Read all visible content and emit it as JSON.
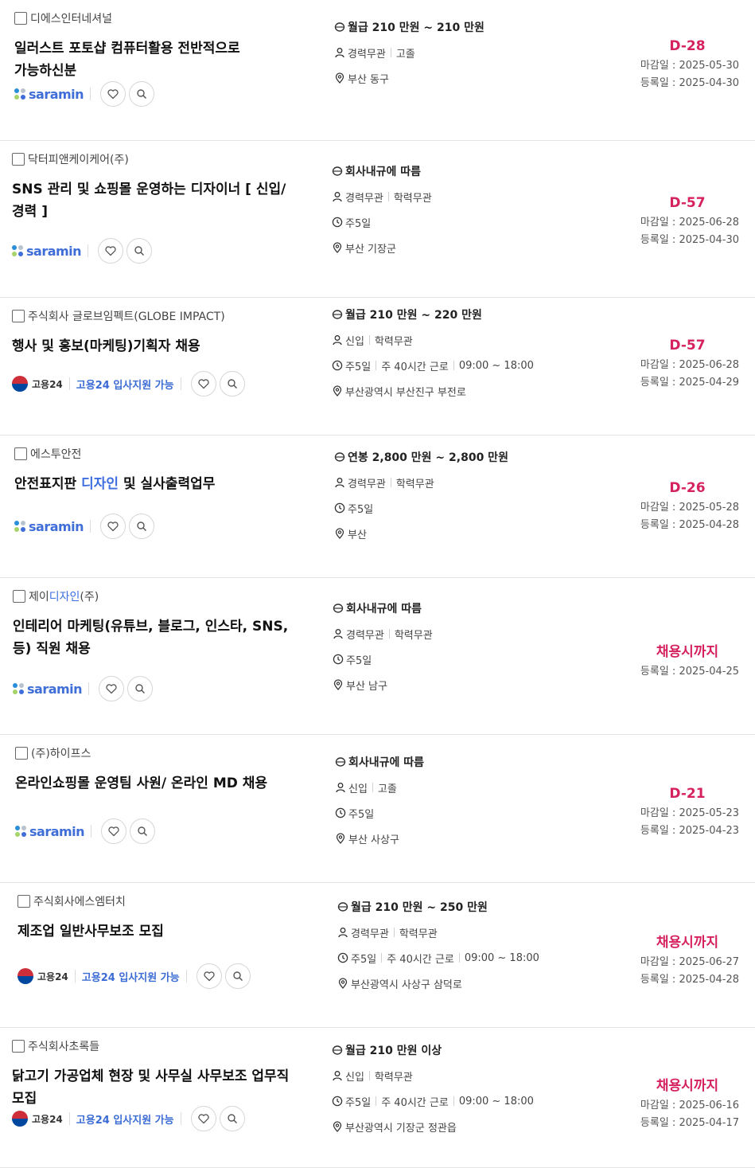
{
  "colors": {
    "accent": "#d6215f",
    "link": "#3b6bd4",
    "saramin": "#3f6ed8"
  },
  "icons": {
    "salary": "coin-icon",
    "career": "person-icon",
    "schedule": "clock-icon",
    "location": "pin-icon",
    "like": "heart-icon",
    "search": "search-icon"
  },
  "jobs": [
    {
      "company": "디에스인터네셔널",
      "title": "일러스트 포토샵 컴퓨터활용 전반적으로 가능하신분",
      "source": "saramin",
      "salary": "월급 210 만원 ~ 210 만원",
      "career": [
        "경력무관",
        "고졸"
      ],
      "schedule": [],
      "location": "부산 동구",
      "dday": "D-28",
      "deadline": "마감일 : 2025-05-30",
      "registered": "등록일 : 2025-04-30"
    },
    {
      "company": "닥터피앤케이케어(주)",
      "title": "SNS 관리 및 쇼핑몰 운영하는 디자이너 [ 신입/경력 ]",
      "source": "saramin",
      "salary": "회사내규에 따름",
      "career": [
        "경력무관",
        "학력무관"
      ],
      "schedule": [
        "주5일"
      ],
      "location": "부산 기장군",
      "dday": "D-57",
      "deadline": "마감일 : 2025-06-28",
      "registered": "등록일 : 2025-04-30"
    },
    {
      "company": "주식회사 글로브임펙트(GLOBE IMPACT)",
      "title": "행사 및 홍보(마케팅)기획자 채용",
      "source": "gov",
      "salary": "월급 210 만원 ~ 220 만원",
      "career": [
        "신입",
        "학력무관"
      ],
      "schedule": [
        "주5일",
        "주 40시간 근로",
        "09:00 ~ 18:00"
      ],
      "location": "부산광역시 부산진구 부전로",
      "dday": "D-57",
      "deadline": "마감일 : 2025-06-28",
      "registered": "등록일 : 2025-04-29"
    },
    {
      "company": "에스투안전",
      "title_pre": "안전표지판 ",
      "title_hl": "디자인",
      "title_post": " 및 실사출력업무",
      "source": "saramin",
      "salary": "연봉 2,800 만원 ~ 2,800 만원",
      "career": [
        "경력무관",
        "학력무관"
      ],
      "schedule": [
        "주5일"
      ],
      "location": "부산",
      "dday": "D-26",
      "deadline": "마감일 : 2025-05-28",
      "registered": "등록일 : 2025-04-28"
    },
    {
      "company_pre": "제이",
      "company_hl": "디자인",
      "company_post": "(주)",
      "title": "인테리어 마케팅(유튜브, 블로그, 인스타, SNS, 등) 직원 채용",
      "source": "saramin",
      "salary": "회사내규에 따름",
      "career": [
        "경력무관",
        "학력무관"
      ],
      "schedule": [
        "주5일"
      ],
      "location": "부산 남구",
      "dday": "채용시까지",
      "deadline": "",
      "registered": "등록일 : 2025-04-25"
    },
    {
      "company": "(주)하이프스",
      "title": "온라인쇼핑몰 운영팀 사원/ 온라인 MD 채용",
      "source": "saramin",
      "salary": "회사내규에 따름",
      "career": [
        "신입",
        "고졸"
      ],
      "schedule": [
        "주5일"
      ],
      "location": "부산 사상구",
      "dday": "D-21",
      "deadline": "마감일 : 2025-05-23",
      "registered": "등록일 : 2025-04-23"
    },
    {
      "company": "주식회사에스엠터치",
      "title": "제조업 일반사무보조 모집",
      "source": "gov",
      "salary": "월급 210 만원 ~ 250 만원",
      "career": [
        "경력무관",
        "학력무관"
      ],
      "schedule": [
        "주5일",
        "주 40시간 근로",
        "09:00 ~ 18:00"
      ],
      "location": "부산광역시 사상구 삼덕로",
      "dday": "채용시까지",
      "deadline": "마감일 : 2025-06-27",
      "registered": "등록일 : 2025-04-28"
    },
    {
      "company": "주식회사초록들",
      "title": "닭고기 가공업체 현장 및 사무실 사무보조 업무직 모집",
      "source": "gov",
      "salary": "월급 210 만원 이상",
      "career": [
        "신입",
        "학력무관"
      ],
      "schedule": [
        "주5일",
        "주 40시간 근로",
        "09:00 ~ 18:00"
      ],
      "location": "부산광역시 기장군 정관읍",
      "dday": "채용시까지",
      "deadline": "마감일 : 2025-06-16",
      "registered": "등록일 : 2025-04-17"
    }
  ],
  "saramin_label": "saramin",
  "gov_label": "고용24",
  "gov_support": "고용24 입사지원 가능"
}
